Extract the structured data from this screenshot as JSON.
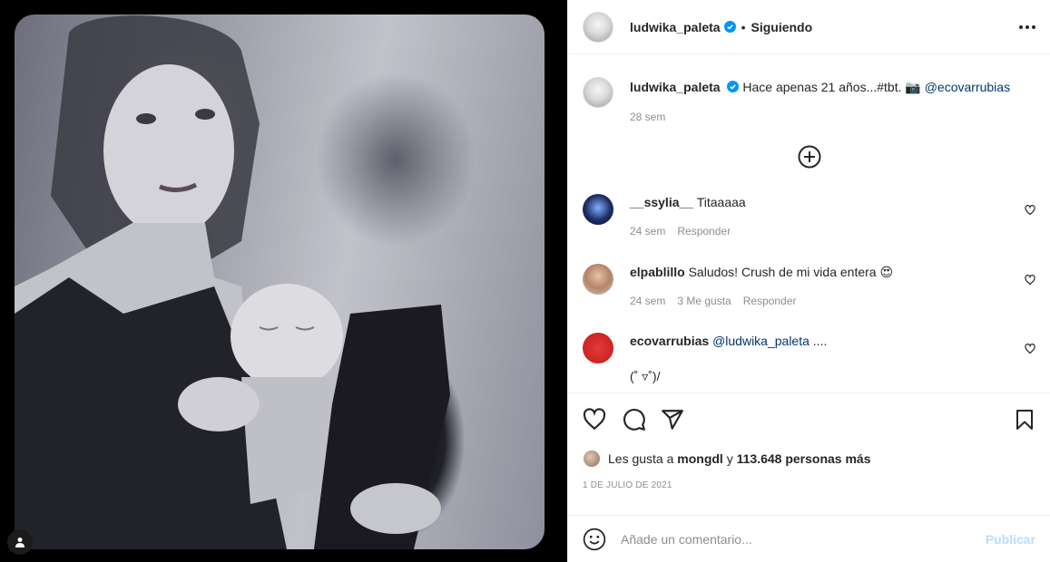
{
  "post": {
    "username": "ludwika_paleta",
    "follow_status": "Siguiendo",
    "caption_text": "Hace apenas 21 años...#tbt. 📷",
    "caption_mention": "@ecovarrubias",
    "caption_time": "28 sem",
    "date": "1 DE JULIO DE 2021"
  },
  "comments": [
    {
      "user": "__ssylia__",
      "text": "Titaaaaa",
      "time": "24 sem",
      "likes": "",
      "reply_label": "Responder"
    },
    {
      "user": "elpablillo",
      "text": "Saludos! Crush de mi vida entera 😍",
      "time": "24 sem",
      "likes": "3 Me gusta",
      "reply_label": "Responder"
    },
    {
      "user": "ecovarrubias",
      "mention": "@ludwika_paleta",
      "text_after": " ....",
      "line2": "(˚ ▿˚)/"
    }
  ],
  "likes": {
    "prefix": "Les gusta a",
    "user": "mongdl",
    "connector": "y",
    "others": "113.648 personas más"
  },
  "composer": {
    "placeholder": "Añade un comentario...",
    "publish_label": "Publicar"
  },
  "colors": {
    "verified": "#0095f6",
    "publish_disabled": "#b2dffc",
    "link": "#00376b"
  }
}
